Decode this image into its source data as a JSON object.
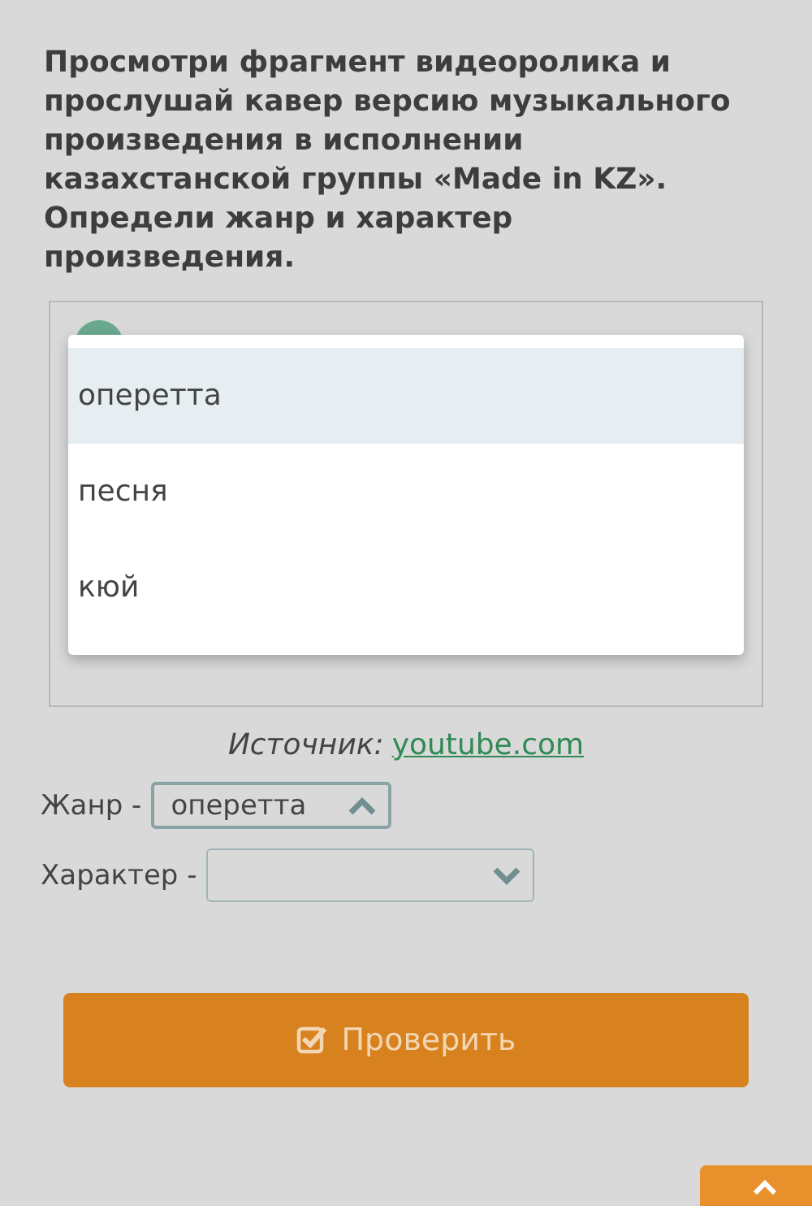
{
  "question": "Просмотри фрагмент видеоролика и прослушай кавер версию музыкального произведения в исполнении казахстанской группы «Made in KZ». Определи жанр и характер произведения.",
  "dropdown": {
    "options": [
      {
        "label": "оперетта",
        "selected": true
      },
      {
        "label": "песня",
        "selected": false
      },
      {
        "label": "кюй",
        "selected": false
      }
    ]
  },
  "source": {
    "label": "Источник:",
    "link": "youtube.com"
  },
  "fields": [
    {
      "label": "Жанр -",
      "value": "оперетта",
      "expanded": true
    },
    {
      "label": "Характер -",
      "expanded": false
    }
  ],
  "check_button": {
    "label": "Проверить"
  }
}
